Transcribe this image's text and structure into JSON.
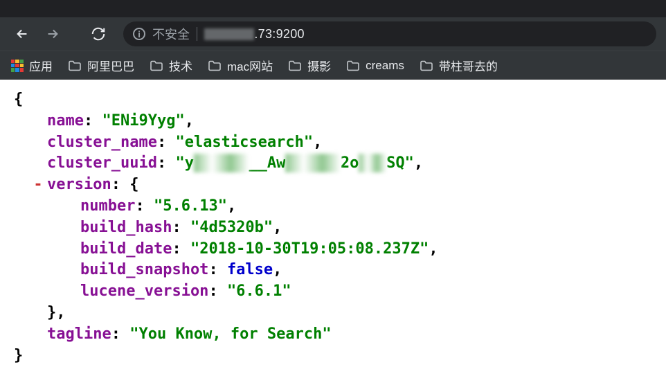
{
  "browser": {
    "insecure_label": "不安全",
    "url_prefix_obscured": "1IJ.2 .. ..",
    "url_visible": ".73:9200"
  },
  "bookmarks": {
    "apps_label": "应用",
    "items": [
      {
        "label": "阿里巴巴"
      },
      {
        "label": "技术"
      },
      {
        "label": "mac网站"
      },
      {
        "label": "摄影"
      },
      {
        "label": "creams"
      },
      {
        "label": "带柱哥去的"
      }
    ]
  },
  "json": {
    "name_key": "name",
    "name_val": "\"ENi9Yyg\"",
    "cluster_name_key": "cluster_name",
    "cluster_name_val": "\"elasticsearch\"",
    "cluster_uuid_key": "cluster_uuid",
    "cluster_uuid_val_start": "\"y",
    "cluster_uuid_val_mid1": "__Aw",
    "cluster_uuid_val_obscured": "XXXXXX",
    "cluster_uuid_val_mid2": "2o",
    "cluster_uuid_val_obscured2": "XXX",
    "cluster_uuid_val_end": "SQ\"",
    "version_key": "version",
    "number_key": "number",
    "number_val": "\"5.6.13\"",
    "build_hash_key": "build_hash",
    "build_hash_val": "\"4d5320b\"",
    "build_date_key": "build_date",
    "build_date_val": "\"2018-10-30T19:05:08.237Z\"",
    "build_snapshot_key": "build_snapshot",
    "build_snapshot_val": "false",
    "lucene_version_key": "lucene_version",
    "lucene_version_val": "\"6.6.1\"",
    "tagline_key": "tagline",
    "tagline_val": "\"You Know, for Search\""
  }
}
